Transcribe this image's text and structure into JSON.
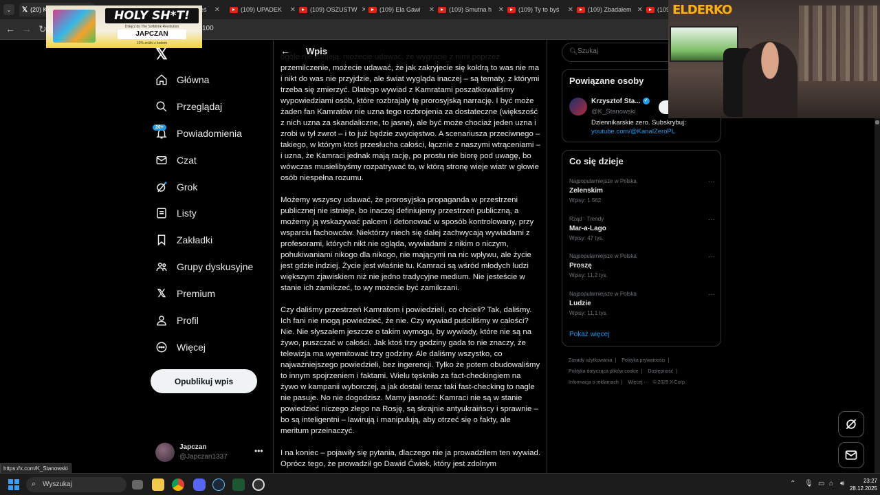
{
  "browser": {
    "tabs": [
      {
        "label": "(20) Krzysztof",
        "icon": "x-icon"
      },
      {
        "label": "(1",
        "icon": "youtube-icon"
      },
      {
        "label": "ałeś",
        "icon": "youtube-icon"
      },
      {
        "label": "(109) UPADEK",
        "icon": "youtube-icon"
      },
      {
        "label": "(109) OSZUSTW",
        "icon": "youtube-icon"
      },
      {
        "label": "(109) Ela Gawi",
        "icon": "youtube-icon"
      },
      {
        "label": "(109) Smutna h",
        "icon": "youtube-icon"
      },
      {
        "label": "(109) Ty to byś",
        "icon": "youtube-icon"
      },
      {
        "label": "(109) Zbadałem",
        "icon": "youtube-icon"
      },
      {
        "label": "(109",
        "icon": "youtube-icon"
      }
    ],
    "url_fragment": "100",
    "status_url": "https://x.com/K_Stanowski"
  },
  "ad": {
    "title": "HOLY SH*T!",
    "subtitle": "Dołącz do The Softdrink Revolution",
    "brand": "JAPCZAN",
    "note": "10% zniżki z kodem"
  },
  "nav": {
    "items": [
      {
        "label": "Główna",
        "icon": "home-icon"
      },
      {
        "label": "Przeglądaj",
        "icon": "search-icon"
      },
      {
        "label": "Powiadomienia",
        "icon": "bell-icon"
      },
      {
        "label": "Czat",
        "icon": "mail-icon"
      },
      {
        "label": "Grok",
        "icon": "grok-icon"
      },
      {
        "label": "Listy",
        "icon": "list-icon"
      },
      {
        "label": "Zakładki",
        "icon": "bookmark-icon"
      },
      {
        "label": "Grupy dyskusyjne",
        "icon": "people-icon"
      },
      {
        "label": "Premium",
        "icon": "x-icon"
      },
      {
        "label": "Profil",
        "icon": "person-icon"
      },
      {
        "label": "Więcej",
        "icon": "more-circle-icon"
      }
    ],
    "notifications_badge": "20+",
    "post_button": "Opublikuj wpis",
    "account": {
      "name": "Japczan",
      "handle": "@Japczan1337"
    }
  },
  "main": {
    "header_title": "Wpis",
    "paragraphs": [
      "ogóle nie istnieją, możecie udawać, że wygracie z nimi poprzez przemilczenie, możecie udawać, że jak zakryjecie się kołdrą to was nie ma i nikt do was nie przyjdzie, ale świat wygląda inaczej – są tematy, z którymi trzeba się zmierzyć. Dlatego wywiad z Kamratami poszatkowaliśmy wypowiedziami osób, które rozbrajały tę prorosyjską narrację. I być może żaden fan Kamratów nie uzna tego rozbrojenia za dostateczne (większość z nich uzna za skandaliczne, to jasne), ale być może chociaż jeden uzna i zrobi w tył zwrot – i to już będzie zwycięstwo. A scenariusza przeciwnego – takiego, w którym ktoś przesłucha całości, łącznie z naszymi wtrąceniami – i uzna, że Kamraci jednak mają rację, po prostu nie biorę pod uwagę, bo wówczas musielibyśmy rozpatrywać to, w którą stronę wieje wiatr w głowie osób niespełna rozumu.",
      "Możemy wszyscy udawać, że prorosyjska propaganda w przestrzeni publicznej nie istnieje, bo inaczej definiujemy przestrzeń publiczną, a możemy ją wskazywać palcem i detonować w sposób kontrolowany, przy wsparciu fachowców. Niektórzy niech się dalej zachwycają wywiadami z profesorami, których nikt nie ogląda, wywiadami z nikim o niczym, pohukiwaniami nikogo dla nikogo, nie mającymi na nic wpływu, ale życie jest gdzie indziej. Życie jest właśnie tu. Kamraci są wśród młodych ludzi większym zjawiskiem niż nie jedno tradycyjne medium. Nie jesteście w stanie ich zamilczeć, to wy możecie być zamilczani.",
      "Czy daliśmy przestrzeń Kamratom i powiedzieli, co chcieli? Tak, daliśmy. Ich fani nie mogą powiedzieć, że nie. Czy wywiad puściliśmy w całości? Nie. Nie słyszałem jeszcze o takim wymogu, by wywiady, które nie są na żywo, puszczać w całości. Jak ktoś trzy godziny gada to nie znaczy, że telewizja ma wyemitować trzy godziny. Ale daliśmy wszystko, co najważniejszego powiedzieli, bez ingerencji. Tylko że potem obudowaliśmy to innym spojrzeniem i faktami. Wielu tęskniło za fact-checkingiem na żywo w kampanii wyborczej, a jak dostali teraz taki fast-checking to nagle nie pasuje. No nie dogodzisz. Mamy jasność: Kamraci nie są w stanie powiedzieć niczego złego na Rosję, są skrajnie antyukraińscy i sprawnie – bo są inteligentni – lawirują i manipulują, aby otrzeć się o fakty, ale meritum przeinaczyć.",
      "I na koniec – pojawiły się pytania, dlaczego nie ja prowadziłem ten wywiad. Oprócz tego, że prowadził go Dawid Ćwiek, który jest zdolnym"
    ]
  },
  "right": {
    "search_placeholder": "Szukaj",
    "related": {
      "title": "Powiązane osoby",
      "name": "Krzysztof Sta...",
      "handle": "@K_Stanowski",
      "bio": "Dziennikarskie zero. Subskrybuj:",
      "link": "youtube.com/@KanalZeroPL"
    },
    "trends": {
      "title": "Co się dzieje",
      "items": [
        {
          "category": "Najpopularniejsze w Polska",
          "name": "Zelenskim",
          "count": "Wpisy: 1 562"
        },
        {
          "category": "Rząd · Trendy",
          "name": "Mar-a-Lago",
          "count": "Wpisy: 47 tys."
        },
        {
          "category": "Najpopularniejsze w Polska",
          "name": "Proszę",
          "count": "Wpisy: 11,2 tys."
        },
        {
          "category": "Najpopularniejsze w Polska",
          "name": "Ludzie",
          "count": "Wpisy: 11,1 tys."
        }
      ],
      "show_more": "Pokaż więcej"
    },
    "footer": [
      "Zasady użytkowania",
      "Polityka prywatności",
      "Polityka dotycząca plików cookie",
      "Dostępność",
      "Informacja o reklamach",
      "Więcej ···",
      "© 2025 X Corp."
    ]
  },
  "webcam": {
    "overlay_logo": "ELDERKO"
  },
  "taskbar": {
    "search_label": "Wyszukaj",
    "time": "23:27",
    "date": "28.12.2025"
  },
  "colors": {
    "accent": "#1d9bf0",
    "background": "#000000",
    "text": "#e7e9ea",
    "muted": "#71767b"
  }
}
